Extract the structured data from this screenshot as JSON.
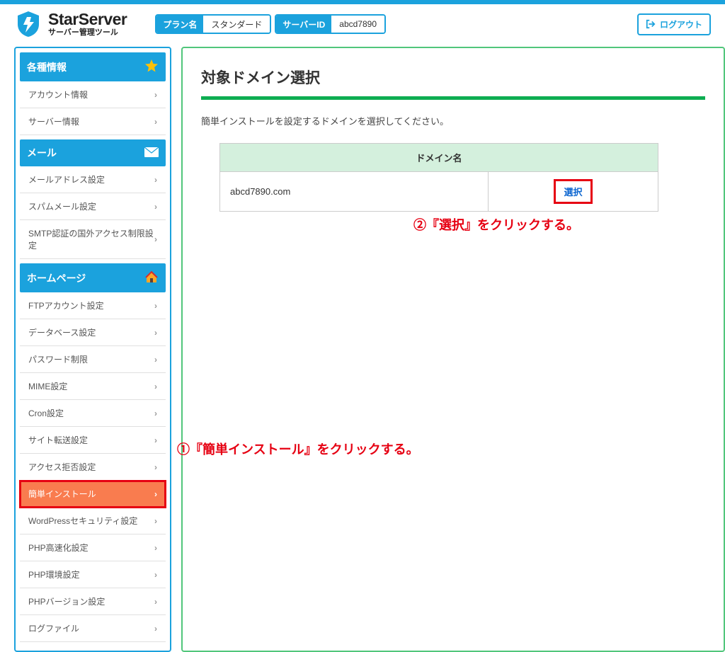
{
  "header": {
    "logo_title": "StarServer",
    "logo_sub": "サーバー管理ツール",
    "plan_label": "プラン名",
    "plan_value": "スタンダード",
    "server_label": "サーバーID",
    "server_value": "abcd7890",
    "logout": "ログアウト"
  },
  "sidebar": {
    "sections": [
      {
        "title": "各種情報",
        "items": [
          {
            "label": "アカウント情報"
          },
          {
            "label": "サーバー情報"
          }
        ]
      },
      {
        "title": "メール",
        "items": [
          {
            "label": "メールアドレス設定"
          },
          {
            "label": "スパムメール設定"
          },
          {
            "label": "SMTP認証の国外アクセス制限設定"
          }
        ]
      },
      {
        "title": "ホームページ",
        "items": [
          {
            "label": "FTPアカウント設定"
          },
          {
            "label": "データベース設定"
          },
          {
            "label": "パスワード制限"
          },
          {
            "label": "MIME設定"
          },
          {
            "label": "Cron設定"
          },
          {
            "label": "サイト転送設定"
          },
          {
            "label": "アクセス拒否設定"
          },
          {
            "label": "簡単インストール",
            "active": true
          },
          {
            "label": "WordPressセキュリティ設定"
          },
          {
            "label": "PHP高速化設定"
          },
          {
            "label": "PHP環境設定"
          },
          {
            "label": "PHPバージョン設定"
          },
          {
            "label": "ログファイル"
          }
        ]
      }
    ]
  },
  "main": {
    "title": "対象ドメイン選択",
    "description": "簡単インストールを設定するドメインを選択してください。",
    "table_header": "ドメイン名",
    "domain": "abcd7890.com",
    "select_label": "選択"
  },
  "annotations": {
    "one": "①『簡単インストール』をクリックする。",
    "two": "②『選択』をクリックする。"
  }
}
